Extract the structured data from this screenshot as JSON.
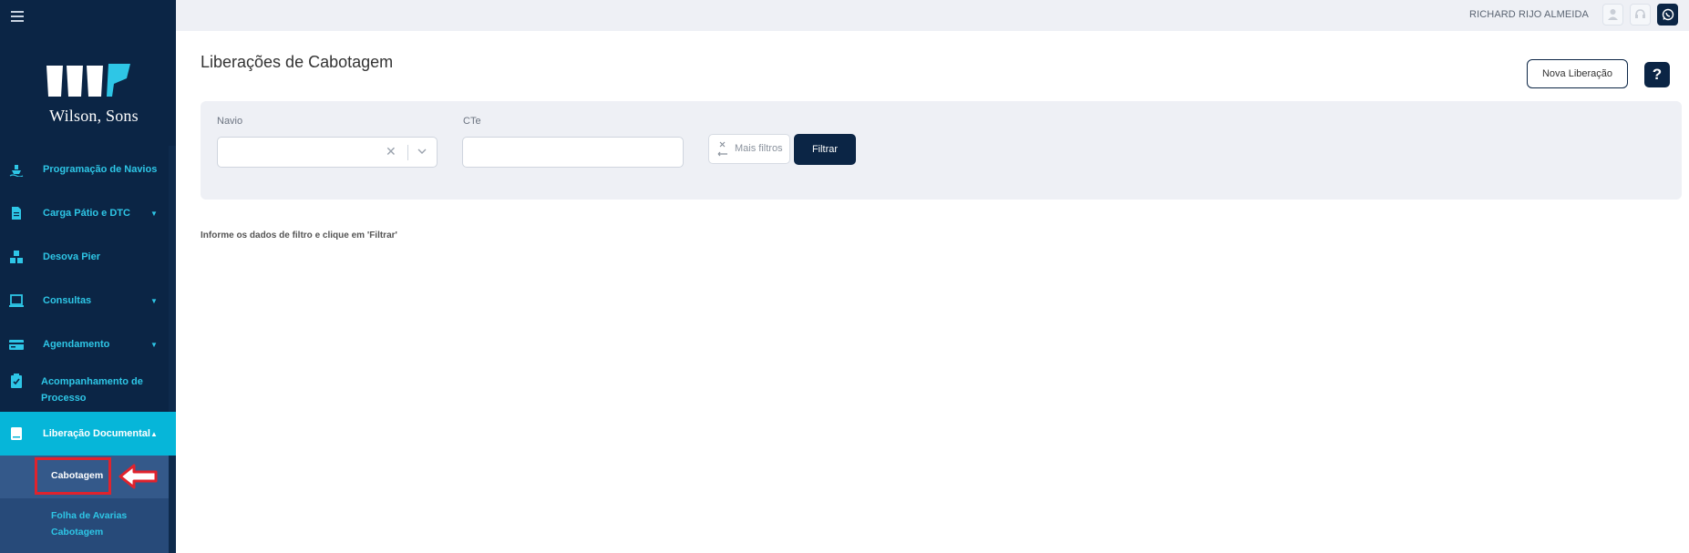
{
  "user": {
    "name": "RICHARD RIJO ALMEIDA"
  },
  "brand": {
    "name": "Wilson, Sons",
    "accent": "#2ec6e6",
    "navy": "#0b2545"
  },
  "sidebar": {
    "items": [
      {
        "label": "Programação de Navios",
        "icon": "ship-icon"
      },
      {
        "label": "Carga Pátio e DTC",
        "icon": "document-icon",
        "expandable": true
      },
      {
        "label": "Desova Pier",
        "icon": "containers-icon"
      },
      {
        "label": "Consultas",
        "icon": "monitor-icon",
        "expandable": true
      },
      {
        "label": "Agendamento",
        "icon": "card-icon",
        "expandable": true
      },
      {
        "label": "Acompanhamento de",
        "label2": "Processo",
        "icon": "clipboard-check-icon"
      },
      {
        "label": "Liberação Documental",
        "icon": "book-icon",
        "expandable": true,
        "active": true
      }
    ],
    "submenu": [
      {
        "label": "Cabotagem",
        "selected": true
      },
      {
        "label": "Folha de Avarias",
        "label2": "Cabotagem"
      }
    ]
  },
  "page": {
    "title": "Liberações de Cabotagem",
    "new_button": "Nova Liberação",
    "help_button": "?"
  },
  "filters": {
    "navio_label": "Navio",
    "cte_label": "CTe",
    "more_filters": "Mais filtros",
    "filter_button": "Filtrar"
  },
  "info_message": "Informe os dados de filtro e clique em 'Filtrar'"
}
